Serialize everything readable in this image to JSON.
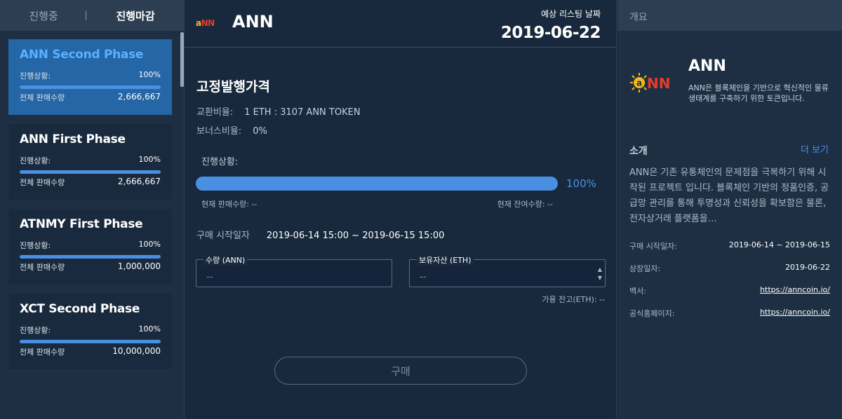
{
  "sidebar": {
    "tabs": [
      "진행중",
      "진행마감"
    ],
    "phases": [
      {
        "name": "ANN Second Phase",
        "progress_label": "진행상황:",
        "progress_value": "100%",
        "progress": 100,
        "total_label": "전체 판매수량",
        "total_value": "2,666,667"
      },
      {
        "name": "ANN First Phase",
        "progress_label": "진행상황:",
        "progress_value": "100%",
        "progress": 100,
        "total_label": "전체 판매수량",
        "total_value": "2,666,667"
      },
      {
        "name": "ATNMY First Phase",
        "progress_label": "진행상황:",
        "progress_value": "100%",
        "progress": 100,
        "total_label": "전체 판매수량",
        "total_value": "1,000,000"
      },
      {
        "name": "XCT Second Phase",
        "progress_label": "진행상황:",
        "progress_value": "100%",
        "progress": 100,
        "total_label": "전체 판매수량",
        "total_value": "10,000,000"
      }
    ]
  },
  "header": {
    "logo_text": "aNN",
    "token_name": "ANN",
    "listing_label": "예상 리스팅 날짜",
    "listing_date": "2019-06-22"
  },
  "main": {
    "section_title": "고정발행가격",
    "exchange_label": "교환비율:",
    "exchange_value": "1 ETH  : 3107 ANN TOKEN",
    "bonus_label": "보너스비율:",
    "bonus_value": "0%",
    "progress_label": "진행상황:",
    "progress": 100,
    "progress_pct": "100%",
    "current_sold": "현재 판매수량: --",
    "current_remaining": "현재 잔여수량: --",
    "sale_start_label": "구매 시작일자",
    "sale_start_value": "2019-06-14 15:00 ~ 2019-06-15 15:00",
    "qty_label": "수량 (ANN)",
    "qty_placeholder": "--",
    "asset_label": "보유자산 (ETH)",
    "asset_placeholder": "--",
    "balance": "가용 잔고(ETH): --",
    "buy_label": "구매"
  },
  "overview": {
    "header": "개요",
    "token_name": "ANN",
    "token_desc": "ANN은 블록체인을 기반으로 혁신적인 물류 생태계를 구축하기 위한 토큰입니다.",
    "intro_title": "소개",
    "more_label": "더 보기",
    "intro_text": "ANN은 기존 유통체인의 문제점을 극복하기 위해 시작된 프로젝트 입니다. 블록체인 기반의 정품인증, 공급망 관리를 통해 투명성과 신뢰성을 확보함은 물론, 전자상거래 플랫폼을…",
    "details": [
      {
        "label": "구매 시작일자:",
        "value": "2019-06-14 ~ 2019-06-15"
      },
      {
        "label": "상장일자:",
        "value": "2019-06-22"
      },
      {
        "label": "백서:",
        "value": "https://anncoin.io/"
      },
      {
        "label": "공식홈페이지:",
        "value": "https://anncoin.io/"
      }
    ]
  },
  "colors": {
    "accent": "#4a90e2",
    "selected": "#2466a6",
    "logo_red": "#e53c2e",
    "logo_gold": "#f6b817"
  }
}
